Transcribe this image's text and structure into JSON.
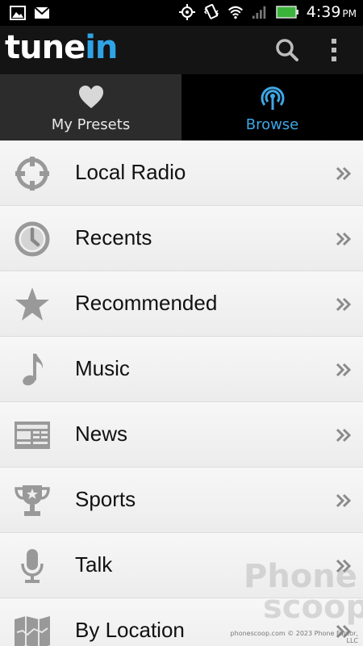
{
  "status_bar": {
    "time": "4:39",
    "ampm": "PM",
    "icons": [
      "gallery-icon",
      "gmail-icon",
      "gps-icon",
      "vibrate-icon",
      "wifi-icon",
      "signal-icon",
      "battery-icon"
    ]
  },
  "app": {
    "logo_main": "tune",
    "logo_accent": "in",
    "accent_color": "#2fa3e6"
  },
  "tabs": [
    {
      "label": "My Presets",
      "icon": "heart-icon",
      "selected": false
    },
    {
      "label": "Browse",
      "icon": "broadcast-icon",
      "selected": true
    }
  ],
  "list": {
    "items": [
      {
        "label": "Local Radio",
        "icon": "crosshair-icon"
      },
      {
        "label": "Recents",
        "icon": "clock-icon"
      },
      {
        "label": "Recommended",
        "icon": "star-icon"
      },
      {
        "label": "Music",
        "icon": "music-note-icon"
      },
      {
        "label": "News",
        "icon": "newspaper-icon"
      },
      {
        "label": "Sports",
        "icon": "trophy-icon"
      },
      {
        "label": "Talk",
        "icon": "microphone-icon"
      },
      {
        "label": "By Location",
        "icon": "map-icon"
      }
    ]
  },
  "watermark": {
    "line1": "Phone",
    "line2": "scoop",
    "footer": "phonescoop.com © 2023 Phone Factor, LLC"
  }
}
